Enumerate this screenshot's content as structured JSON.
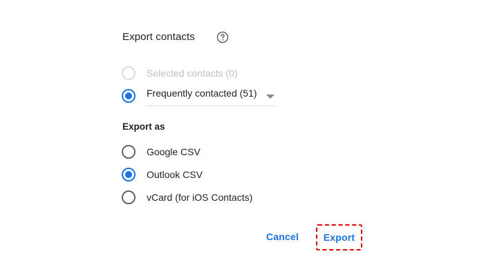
{
  "dialog": {
    "title": "Export contacts",
    "help_icon": "help-circle-icon"
  },
  "export_scope": {
    "options": [
      {
        "label": "Selected contacts (0)",
        "state": "disabled"
      },
      {
        "label": "Frequently contacted (51)",
        "state": "checked"
      }
    ],
    "dropdown_value": "Frequently contacted (51)"
  },
  "export_format": {
    "heading": "Export as",
    "options": [
      {
        "label": "Google CSV",
        "state": "unchecked"
      },
      {
        "label": "Outlook CSV",
        "state": "checked"
      },
      {
        "label": "vCard (for iOS Contacts)",
        "state": "unchecked"
      }
    ]
  },
  "actions": {
    "cancel_label": "Cancel",
    "export_label": "Export"
  },
  "colors": {
    "accent": "#1a73e8",
    "highlight_border": "#e00000",
    "text": "#202124",
    "disabled_text": "#bdc1c6"
  }
}
